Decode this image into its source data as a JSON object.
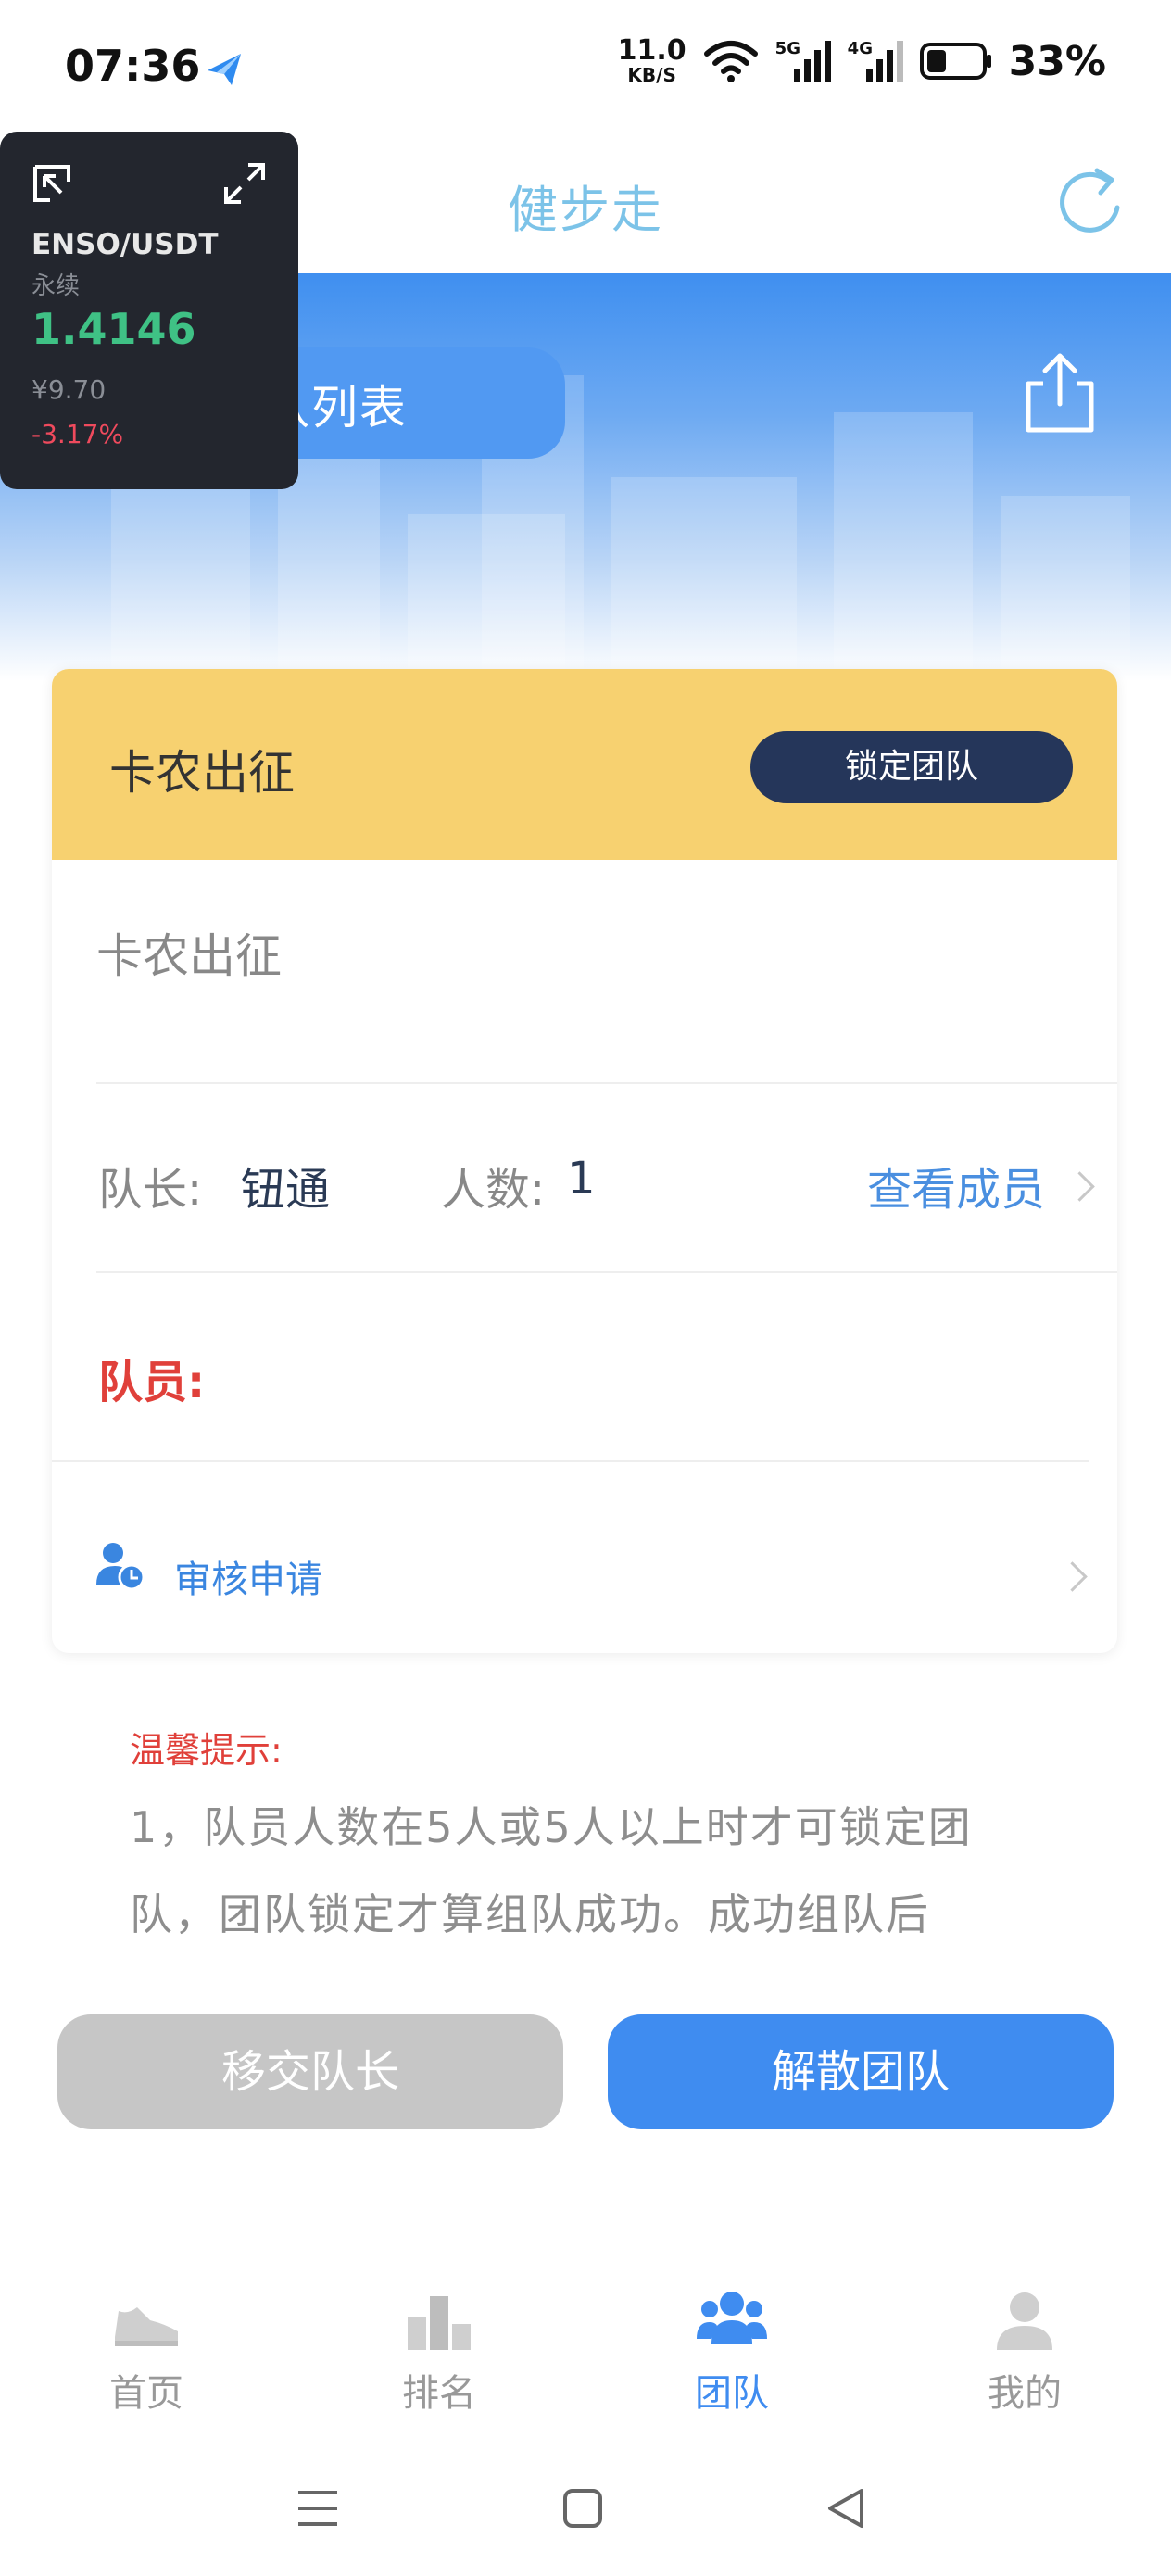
{
  "status_bar": {
    "time": "07:36",
    "net_speed_value": "11.0",
    "net_speed_unit": "KB/S",
    "signal_1": "5G",
    "signal_2": "4G",
    "battery": "33%"
  },
  "header": {
    "title": "健步走"
  },
  "banner": {
    "team_list_label": "团队列表"
  },
  "ticker": {
    "symbol": "ENSO/USDT",
    "type": "永续",
    "price": "1.4146",
    "cny_price": "¥9.70",
    "change": "-3.17%"
  },
  "team_card": {
    "header_name": "卡农出征",
    "lock_button": "锁定团队",
    "team_name": "卡农出征",
    "leader_label": "队长:",
    "leader_value": "钮通",
    "count_label": "人数:",
    "count_value": "1",
    "view_members": "查看成员",
    "members_label": "队员:",
    "audit_label": "审核申请"
  },
  "tips": {
    "title": "温馨提示:",
    "line1": "1，队员人数在5人或5人以上时才可锁定团",
    "line2": "队，团队锁定才算组队成功。成功组队后"
  },
  "actions": {
    "transfer": "移交队长",
    "disband": "解散团队"
  },
  "tabbar": {
    "items": [
      {
        "label": "首页",
        "icon": "shoe-icon"
      },
      {
        "label": "排名",
        "icon": "ranking-icon"
      },
      {
        "label": "团队",
        "icon": "team-icon"
      },
      {
        "label": "我的",
        "icon": "profile-icon"
      }
    ],
    "active": "团队"
  },
  "colors": {
    "accent": "#3f8cf0",
    "card_header": "#f7d170",
    "lock_button": "#25365a",
    "warning": "#e0403a"
  }
}
